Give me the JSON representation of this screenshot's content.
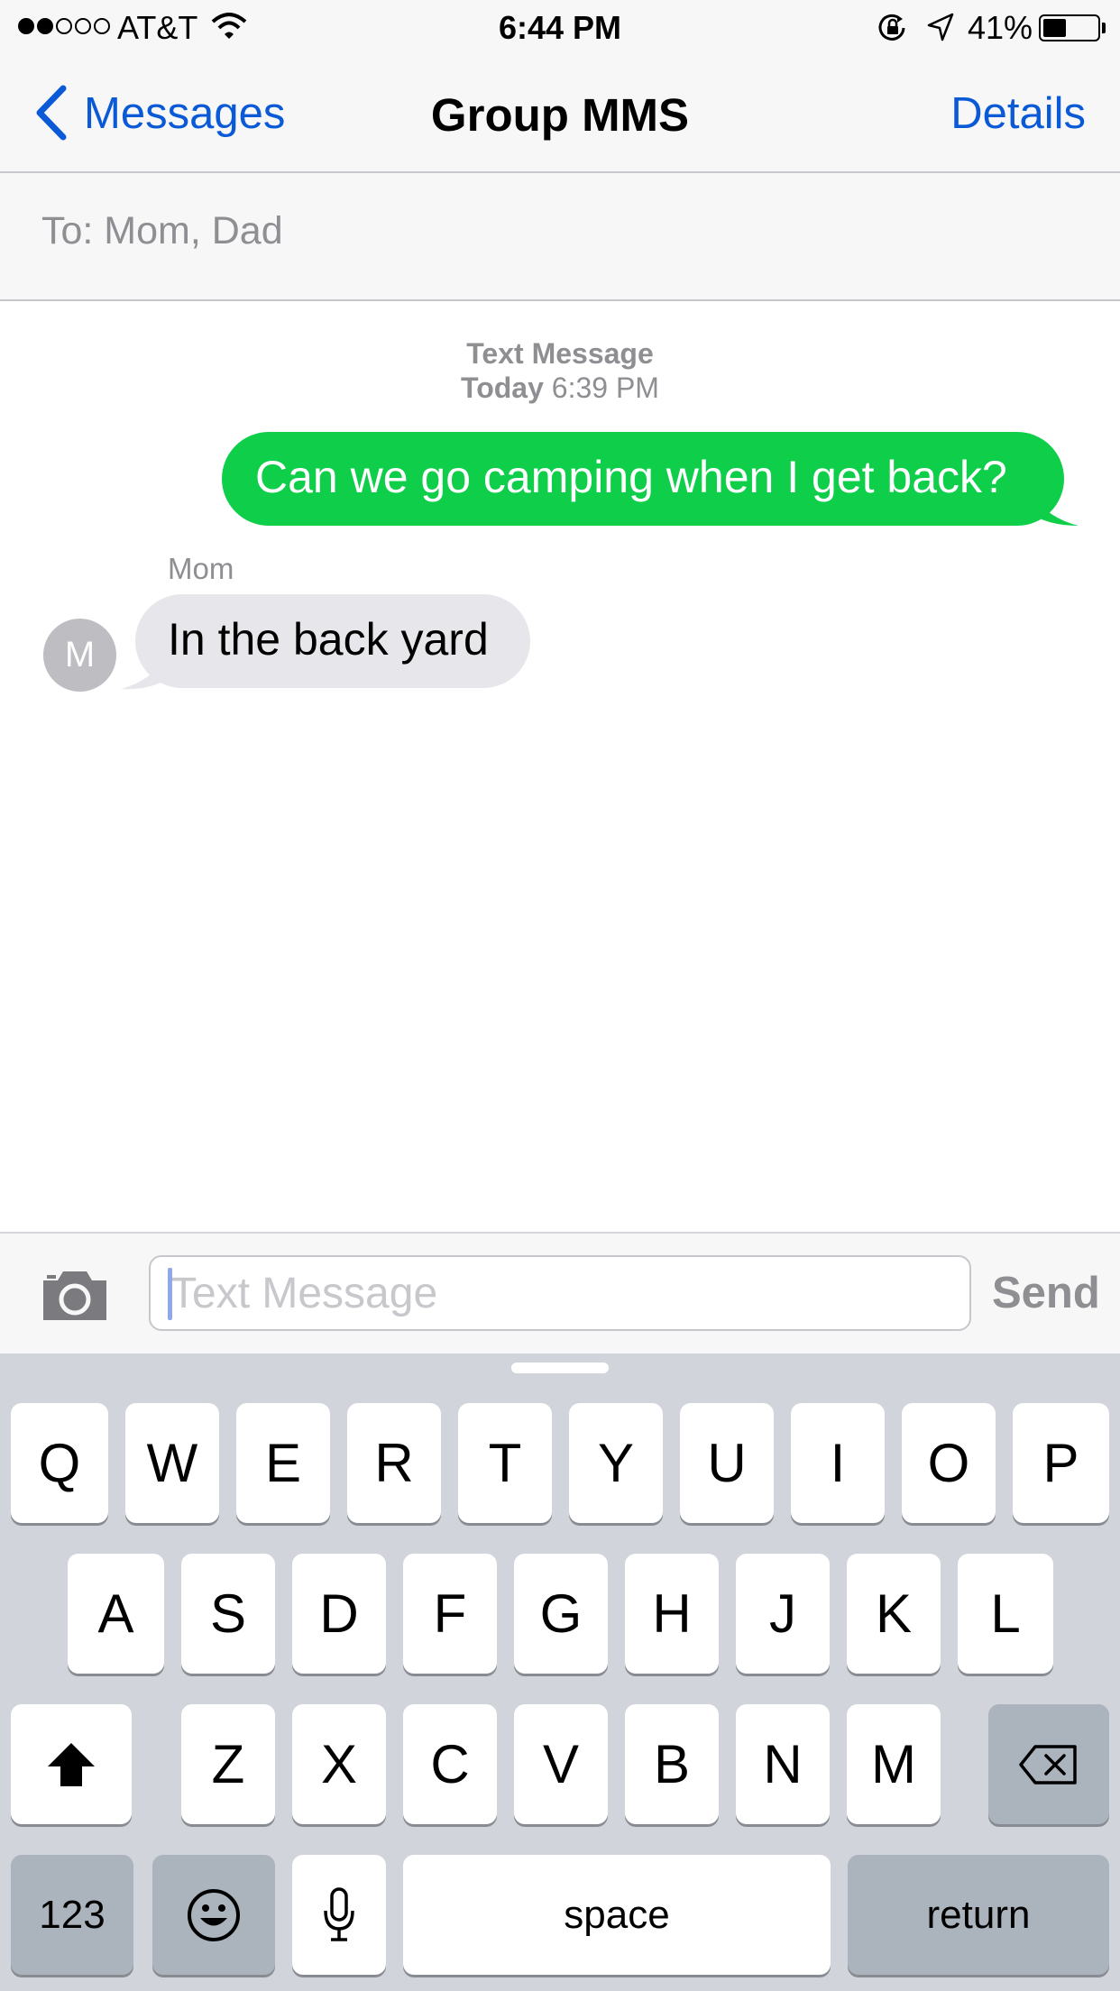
{
  "status_bar": {
    "signal_dots": [
      true,
      true,
      false,
      false,
      false
    ],
    "carrier": "AT&T",
    "time": "6:44 PM",
    "battery_percent": "41%",
    "battery_level": 0.41,
    "icons": [
      "wifi-icon",
      "orientation-lock-icon",
      "location-icon",
      "battery-icon"
    ]
  },
  "nav": {
    "back_label": "Messages",
    "title": "Group MMS",
    "details_label": "Details",
    "accent_color": "#0a59d6"
  },
  "to_field": {
    "text": "To: Mom, Dad"
  },
  "thread": {
    "header_title": "Text Message",
    "header_day": "Today",
    "header_time": "6:39 PM",
    "messages": [
      {
        "direction": "outgoing",
        "text": "Can we go camping when I get back?",
        "color": "#0fce4a"
      },
      {
        "direction": "incoming",
        "sender": "Mom",
        "avatar_initial": "M",
        "text": "In the back yard",
        "color": "#e6e6eb"
      }
    ]
  },
  "input_bar": {
    "placeholder": "Text Message",
    "value": "",
    "send_label": "Send",
    "camera_icon": "camera-icon"
  },
  "keyboard": {
    "row1": [
      "Q",
      "W",
      "E",
      "R",
      "T",
      "Y",
      "U",
      "I",
      "O",
      "P"
    ],
    "row2": [
      "A",
      "S",
      "D",
      "F",
      "G",
      "H",
      "J",
      "K",
      "L"
    ],
    "row3": [
      "Z",
      "X",
      "C",
      "V",
      "B",
      "N",
      "M"
    ],
    "shift_icon": "shift-icon",
    "delete_icon": "delete-icon",
    "numbers_label": "123",
    "emoji_icon": "emoji-icon",
    "mic_icon": "microphone-icon",
    "space_label": "space",
    "return_label": "return"
  }
}
